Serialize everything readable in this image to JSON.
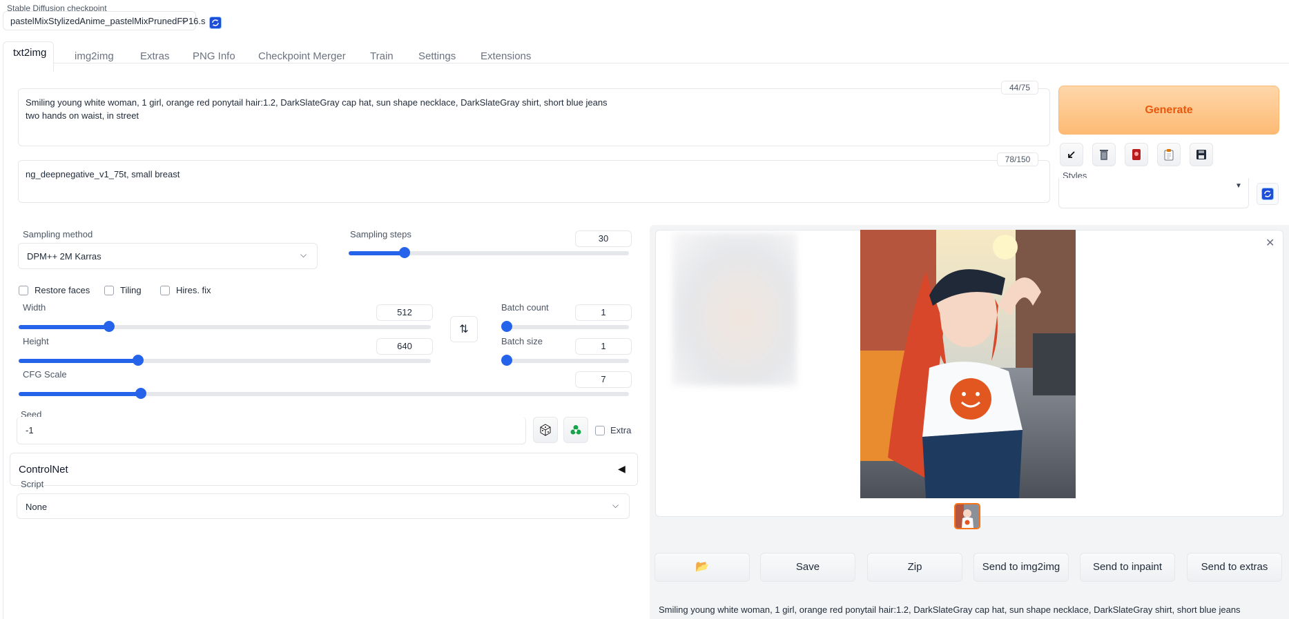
{
  "checkpoint": {
    "label": "Stable Diffusion checkpoint",
    "value": "pastelMixStylizedAnime_pastelMixPrunedFP16.s"
  },
  "tabs": [
    "txt2img",
    "img2img",
    "Extras",
    "PNG Info",
    "Checkpoint Merger",
    "Train",
    "Settings",
    "Extensions"
  ],
  "prompt": {
    "line1": "Smiling young white woman, 1 girl, orange red ponytail hair:1.2, DarkSlateGray cap hat, sun shape necklace, DarkSlateGray shirt, short blue jeans",
    "line2": "two hands on waist, in street",
    "counter": "44/75"
  },
  "negative_prompt": {
    "value": "ng_deepnegative_v1_75t, small breast",
    "counter": "78/150"
  },
  "generate_label": "Generate",
  "styles_label": "Styles",
  "sampling": {
    "method_label": "Sampling method",
    "method_value": "DPM++ 2M Karras",
    "steps_label": "Sampling steps",
    "steps_value": "30"
  },
  "checkboxes": {
    "restore_faces": "Restore faces",
    "tiling": "Tiling",
    "hires_fix": "Hires. fix"
  },
  "width": {
    "label": "Width",
    "value": "512"
  },
  "height": {
    "label": "Height",
    "value": "640"
  },
  "batch_count": {
    "label": "Batch count",
    "value": "1"
  },
  "batch_size": {
    "label": "Batch size",
    "value": "1"
  },
  "cfg": {
    "label": "CFG Scale",
    "value": "7"
  },
  "seed": {
    "label": "Seed",
    "value": "-1",
    "extra_label": "Extra"
  },
  "controlnet": {
    "label": "ControlNet"
  },
  "script": {
    "label": "Script",
    "value": "None"
  },
  "output_buttons": {
    "save": "Save",
    "zip": "Zip",
    "send_img2img": "Send to img2img",
    "send_inpaint": "Send to inpaint",
    "send_extras": "Send to extras"
  },
  "output_info": "Smiling young white woman, 1 girl, orange red ponytail hair:1.2, DarkSlateGray cap hat, sun shape necklace, DarkSlateGray shirt, short blue jeans",
  "sliders": {
    "sampling_steps": 0.2,
    "width": 0.22,
    "height": 0.29,
    "batch_count": 0.0,
    "batch_size": 0.0,
    "cfg": 0.2
  },
  "colors": {
    "accent": "#2563eb",
    "generate_bg": "#fed7aa",
    "generate_text": "#ea580c",
    "selected_thumb_border": "#f97316"
  }
}
